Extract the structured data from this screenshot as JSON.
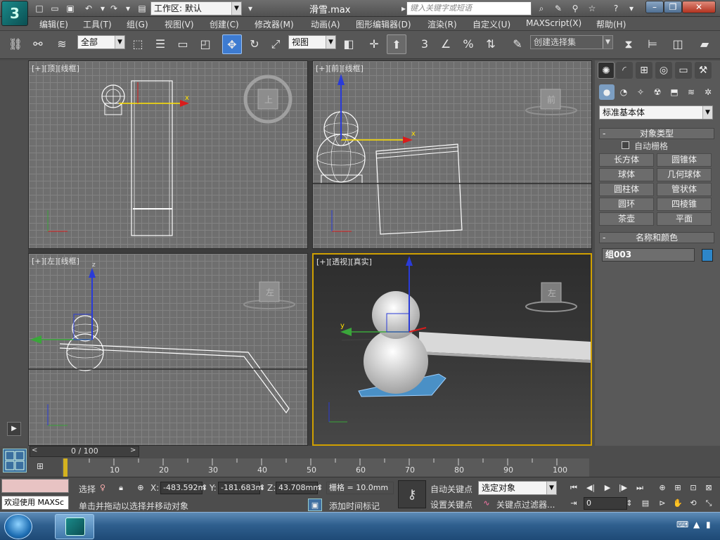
{
  "titlebar": {
    "workspace_label": "工作区: 默认",
    "filename": "滑雪.max",
    "search_placeholder": "键入关键字或短语"
  },
  "menubar": {
    "items": [
      "编辑(E)",
      "工具(T)",
      "组(G)",
      "视图(V)",
      "创建(C)",
      "修改器(M)",
      "动画(A)",
      "图形编辑器(D)",
      "渲染(R)",
      "自定义(U)",
      "MAXScript(X)",
      "帮助(H)"
    ]
  },
  "toolbar": {
    "selection_filter": "全部",
    "ref_coord": "视图",
    "snap_angle_label": "3",
    "named_selection_placeholder": "创建选择集"
  },
  "viewports": {
    "top": {
      "label": "[+][顶][线框]",
      "cube_face": "上"
    },
    "front": {
      "label": "[+][前][线框]",
      "cube_face": "前"
    },
    "left": {
      "label": "[+][左][线框]",
      "cube_face": "左"
    },
    "persp": {
      "label": "[+][透视][真实]",
      "cube_face": "左"
    }
  },
  "cmdpanel": {
    "category": "标准基本体",
    "object_type_header": "对象类型",
    "autogrid_label": "自动栅格",
    "object_buttons": [
      "长方体",
      "圆锥体",
      "球体",
      "几何球体",
      "圆柱体",
      "管状体",
      "圆环",
      "四棱锥",
      "茶壶",
      "平面"
    ],
    "name_color_header": "名称和颜色",
    "object_name": "组003",
    "object_color": "#2d86c9"
  },
  "timeline": {
    "frame_display": "0 / 100",
    "ticks": [
      "10",
      "20",
      "30",
      "40",
      "50",
      "60",
      "70",
      "80",
      "90",
      "100"
    ]
  },
  "status": {
    "maxscript_label": "欢迎使用 MAXSc",
    "selection_label": "选择",
    "x_label": "X:",
    "x_value": "-483.592m",
    "y_label": "Y:",
    "y_value": "-181.683m",
    "z_label": "Z:",
    "z_value": "43.708mm",
    "grid_label": "栅格 = 10.0mm",
    "prompt": "单击并拖动以选择并移动对象",
    "add_time_tag": "添加时间标记",
    "auto_key": "自动关键点",
    "set_key": "设置关键点",
    "key_mode": "选定对象",
    "key_filters": "关键点过滤器...",
    "current_frame": "0"
  }
}
